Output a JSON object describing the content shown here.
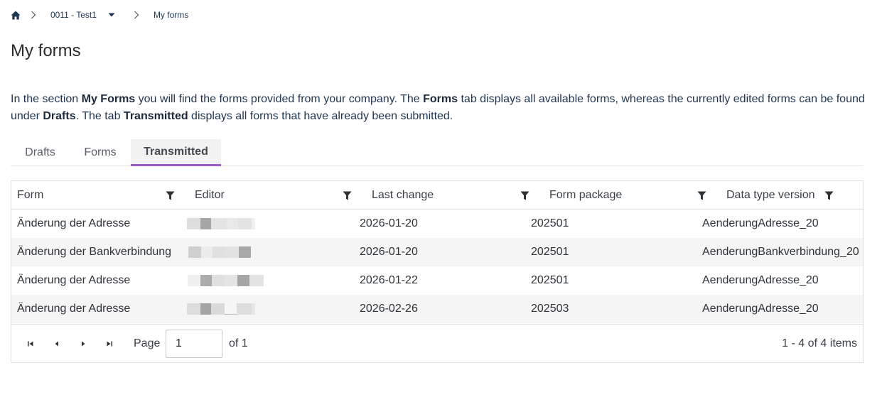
{
  "breadcrumb": {
    "home_icon": "home-icon",
    "company": "0011 - Test1",
    "current": "My forms"
  },
  "page": {
    "title": "My forms"
  },
  "intro": {
    "part1": "In the section ",
    "bold1": "My Forms",
    "part2": " you will find the forms provided from your company. The ",
    "bold2": "Forms",
    "part3": " tab displays all available forms, whereas the currently edited forms can be found under ",
    "bold3": "Drafts",
    "part4": ". The tab ",
    "bold4": "Transmitted",
    "part5": " displays all forms that have already been submitted."
  },
  "tabs": [
    {
      "label": "Drafts",
      "active": false
    },
    {
      "label": "Forms",
      "active": false
    },
    {
      "label": "Transmitted",
      "active": true
    }
  ],
  "grid": {
    "columns": [
      "Form",
      "Editor",
      "Last change",
      "Form package",
      "Data type version"
    ],
    "rows": [
      {
        "form": "Änderung der Adresse",
        "last_change": "2026-01-20",
        "form_package": "202501",
        "data_type_version": "AenderungAdresse_20"
      },
      {
        "form": "Änderung der Bankverbindung",
        "last_change": "2026-01-20",
        "form_package": "202501",
        "data_type_version": "AenderungBankverbindung_20"
      },
      {
        "form": "Änderung der Adresse",
        "last_change": "2026-01-22",
        "form_package": "202501",
        "data_type_version": "AenderungAdresse_20"
      },
      {
        "form": "Änderung der Adresse",
        "last_change": "2026-02-26",
        "form_package": "202503",
        "data_type_version": "AenderungAdresse_20"
      }
    ]
  },
  "pager": {
    "page_label": "Page",
    "page_value": "1",
    "of_label": "of 1",
    "items_label": "1 - 4 of 4 items"
  },
  "colors": {
    "accent": "#9b59c9",
    "text": "#1f3550",
    "row_alt": "#f5f5f5"
  }
}
